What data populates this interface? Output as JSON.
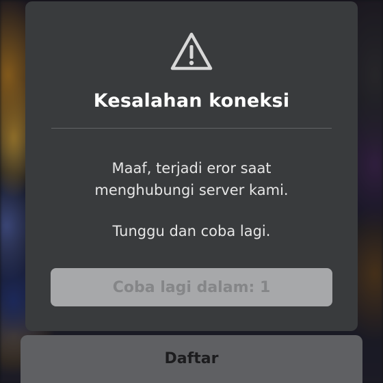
{
  "dialog": {
    "icon": "warning-triangle-icon",
    "title": "Kesalahan koneksi",
    "message_line1": "Maaf, terjadi eror saat",
    "message_line2": "menghubungi server kami.",
    "message_line3": "Tunggu dan coba lagi.",
    "retry_button_label": "Coba lagi dalam: 1"
  },
  "footer": {
    "signup_button_label": "Daftar"
  },
  "colors": {
    "dialog_bg": "#393b3d",
    "retry_button_bg": "#a7a8aa",
    "retry_button_text": "#858688",
    "secondary_button_bg": "#5f6063",
    "title_text": "#ffffff"
  }
}
